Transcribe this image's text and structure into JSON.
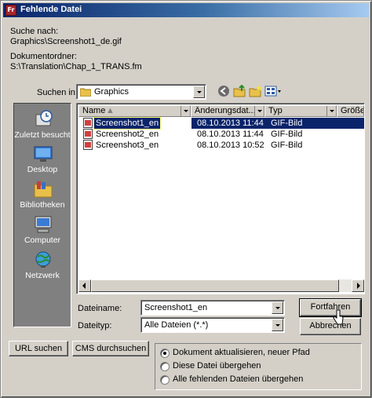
{
  "window": {
    "title": "Fehlende Datei",
    "app_icon_text": "Fr"
  },
  "info": {
    "search_label": "Suche nach:",
    "search_value": "Graphics\\Screenshot1_de.gif",
    "doc_folder_label": "Dokumentordner:",
    "doc_folder_value": "S:\\Translation\\Chap_1_TRANS.fm"
  },
  "lookin": {
    "label": "Suchen in:",
    "value": "Graphics"
  },
  "places": [
    {
      "label": "Zuletzt besucht",
      "icon": "recent-icon"
    },
    {
      "label": "Desktop",
      "icon": "desktop-icon"
    },
    {
      "label": "Bibliotheken",
      "icon": "libraries-icon"
    },
    {
      "label": "Computer",
      "icon": "computer-icon"
    },
    {
      "label": "Netzwerk",
      "icon": "network-icon"
    }
  ],
  "columns": [
    "Name",
    "Änderungsdat...",
    "Typ",
    "Größe"
  ],
  "files": [
    {
      "name": "Screenshot1_en",
      "date": "08.10.2013 11:44",
      "type": "GIF-Bild",
      "selected": true
    },
    {
      "name": "Screenshot2_en",
      "date": "08.10.2013 11:44",
      "type": "GIF-Bild",
      "selected": false
    },
    {
      "name": "Screenshot3_en",
      "date": "08.10.2013 10:52",
      "type": "GIF-Bild",
      "selected": false
    }
  ],
  "filename": {
    "label": "Dateiname:",
    "value": "Screenshot1_en"
  },
  "filetype": {
    "label": "Dateityp:",
    "value": "Alle Dateien (*.*)"
  },
  "buttons": {
    "continue": "Fortfahren",
    "cancel": "Abbrechen",
    "url_search": "URL suchen",
    "cms_search": "CMS durchsuchen"
  },
  "options": [
    {
      "label": "Dokument aktualisieren, neuer Pfad",
      "checked": true
    },
    {
      "label": "Diese Datei übergehen",
      "checked": false
    },
    {
      "label": "Alle fehlenden Dateien übergehen",
      "checked": false
    }
  ],
  "colors": {
    "title_start": "#0a246a",
    "title_end": "#a6caf0",
    "face": "#d4d0c8",
    "selection": "#0a246a",
    "places_bg": "#808080"
  }
}
